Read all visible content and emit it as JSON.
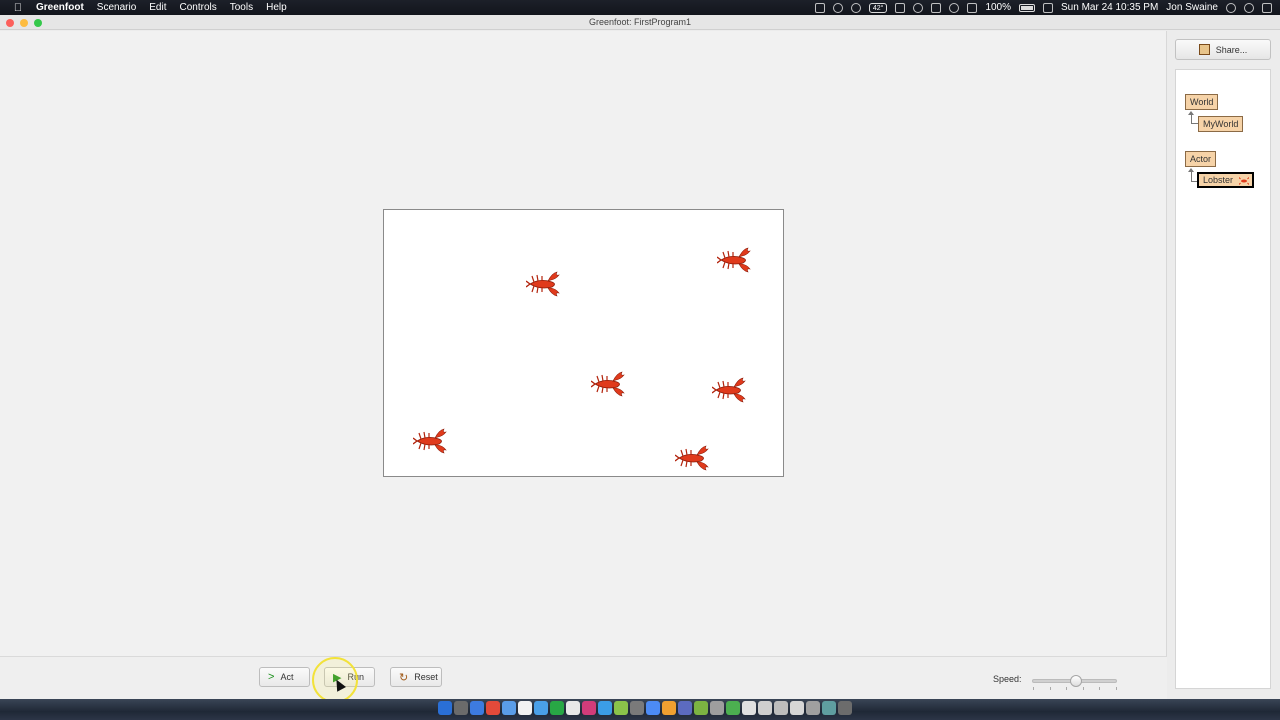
{
  "menubar": {
    "app_name": "Greenfoot",
    "menus": [
      "Scenario",
      "Edit",
      "Controls",
      "Tools",
      "Help"
    ],
    "temperature": "42°",
    "battery": "100%",
    "datetime": "Sun Mar 24  10:35 PM",
    "user": "Jon Swaine"
  },
  "window": {
    "title": "Greenfoot: FirstProgram1"
  },
  "controls": {
    "act_label": "Act",
    "run_label": "Run",
    "reset_label": "Reset",
    "speed_label": "Speed:",
    "speed_value": 0.5
  },
  "side": {
    "share_label": "Share...",
    "classes": {
      "world": "World",
      "myworld": "MyWorld",
      "actor": "Actor",
      "lobster": "Lobster"
    }
  },
  "world": {
    "actors": [
      {
        "name": "lobster-1"
      },
      {
        "name": "lobster-2"
      },
      {
        "name": "lobster-3"
      },
      {
        "name": "lobster-4"
      },
      {
        "name": "lobster-5"
      },
      {
        "name": "lobster-6"
      }
    ]
  },
  "colors": {
    "lobster": "#e03a1c",
    "class_box": "#f6d3a8",
    "run_icon": "#1a8f1a"
  }
}
